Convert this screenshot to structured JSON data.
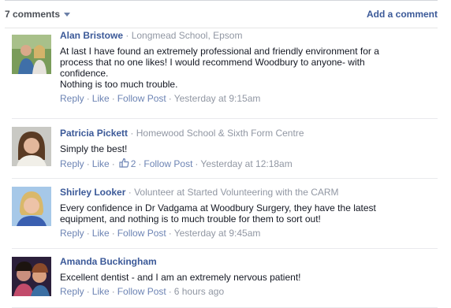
{
  "header": {
    "count_label": "7 comments",
    "add_comment_label": "Add a comment"
  },
  "colors": {
    "link": "#3b5998",
    "meta": "#9197a3",
    "action": "#6d84b4"
  },
  "comments": [
    {
      "author": "Alan Bristowe",
      "affiliation": "Longmead School, Epsom",
      "text_lines": [
        "At last I have found an extremely professional and friendly environment for a",
        "process that no one likes! I would recommend Woodbury to anyone- with",
        "confidence.",
        "Nothing is too much trouble."
      ],
      "reply": "Reply",
      "like": "Like",
      "follow": "Follow Post",
      "time": "Yesterday at 9:15am"
    },
    {
      "author": "Patricia Pickett",
      "affiliation": "Homewood School & Sixth Form Centre",
      "text_lines": [
        "Simply the best!"
      ],
      "reply": "Reply",
      "like": "Like",
      "like_count": "2",
      "follow": "Follow Post",
      "time": "Yesterday at 12:18am"
    },
    {
      "author": "Shirley Looker",
      "affiliation": "Volunteer at Started Volunteering with the CARM",
      "text_lines": [
        "Every confidence in Dr Vadgama at Woodbury Surgery, they have the latest",
        "equipment, and nothing is to much trouble for them to sort out!"
      ],
      "reply": "Reply",
      "like": "Like",
      "follow": "Follow Post",
      "time": "Yesterday at 9:45am"
    },
    {
      "author": "Amanda Buckingham",
      "affiliation": "",
      "text_lines": [
        "Excellent dentist - and I am an extremely nervous patient!"
      ],
      "reply": "Reply",
      "like": "Like",
      "follow": "Follow Post",
      "time": "6 hours ago"
    }
  ]
}
